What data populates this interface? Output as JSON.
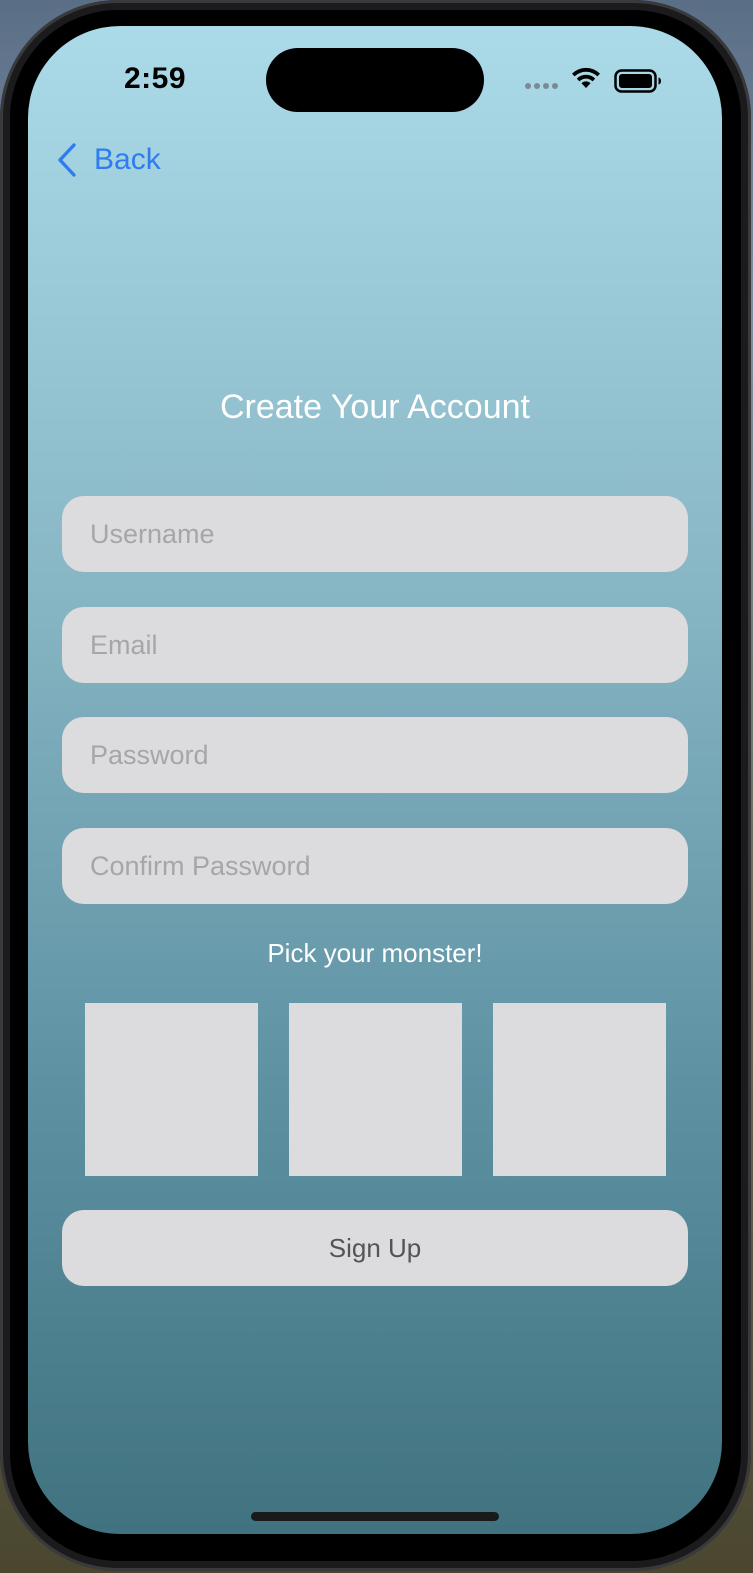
{
  "status_bar": {
    "time": "2:59"
  },
  "nav": {
    "back_label": "Back"
  },
  "form": {
    "title": "Create Your Account",
    "username_placeholder": "Username",
    "email_placeholder": "Email",
    "password_placeholder": "Password",
    "confirm_password_placeholder": "Confirm Password",
    "monster_prompt": "Pick your monster!",
    "monster_option_count": 3,
    "sign_up_label": "Sign Up"
  },
  "colors": {
    "accent": "#2f7bf0",
    "gradient_top": "#abdae8",
    "gradient_bottom": "#40727f",
    "field_background": "#dcdcde"
  },
  "icons": [
    "wifi-icon",
    "battery-icon",
    "cellular-signal-icon",
    "chevron-left-icon"
  ]
}
